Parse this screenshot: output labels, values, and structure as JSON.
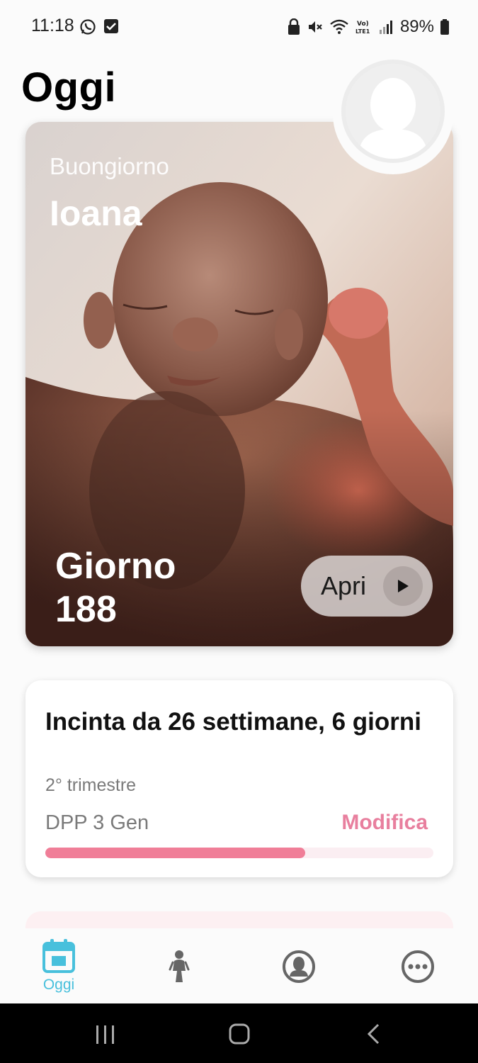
{
  "status_bar": {
    "time": "11:18",
    "battery": "89%",
    "icons": [
      "whatsapp-icon",
      "check-square-icon",
      "lock-icon",
      "mute-icon",
      "wifi-icon",
      "volte-icon",
      "signal-icon",
      "battery-icon"
    ]
  },
  "page": {
    "title": "Oggi"
  },
  "hero": {
    "greeting": "Buongiorno",
    "name": "Ioana",
    "day_label": "Giorno",
    "day_number": "188",
    "open_label": "Apri"
  },
  "pregnancy": {
    "title": "Incinta da  26 settimane, 6 giorni",
    "trimester": "2° trimestre",
    "due_date": "DPP 3 Gen",
    "edit_label": "Modifica",
    "progress_fraction": 0.67
  },
  "bottom_nav": {
    "items": [
      {
        "label": "Oggi",
        "icon": "calendar-icon",
        "active": true
      },
      {
        "label": "",
        "icon": "baby-icon",
        "active": false
      },
      {
        "label": "",
        "icon": "profile-circle-icon",
        "active": false
      },
      {
        "label": "",
        "icon": "more-icon",
        "active": false
      }
    ]
  },
  "colors": {
    "accent": "#48c0dc",
    "pink": "#e87f9e",
    "progress": "#f07e98"
  }
}
